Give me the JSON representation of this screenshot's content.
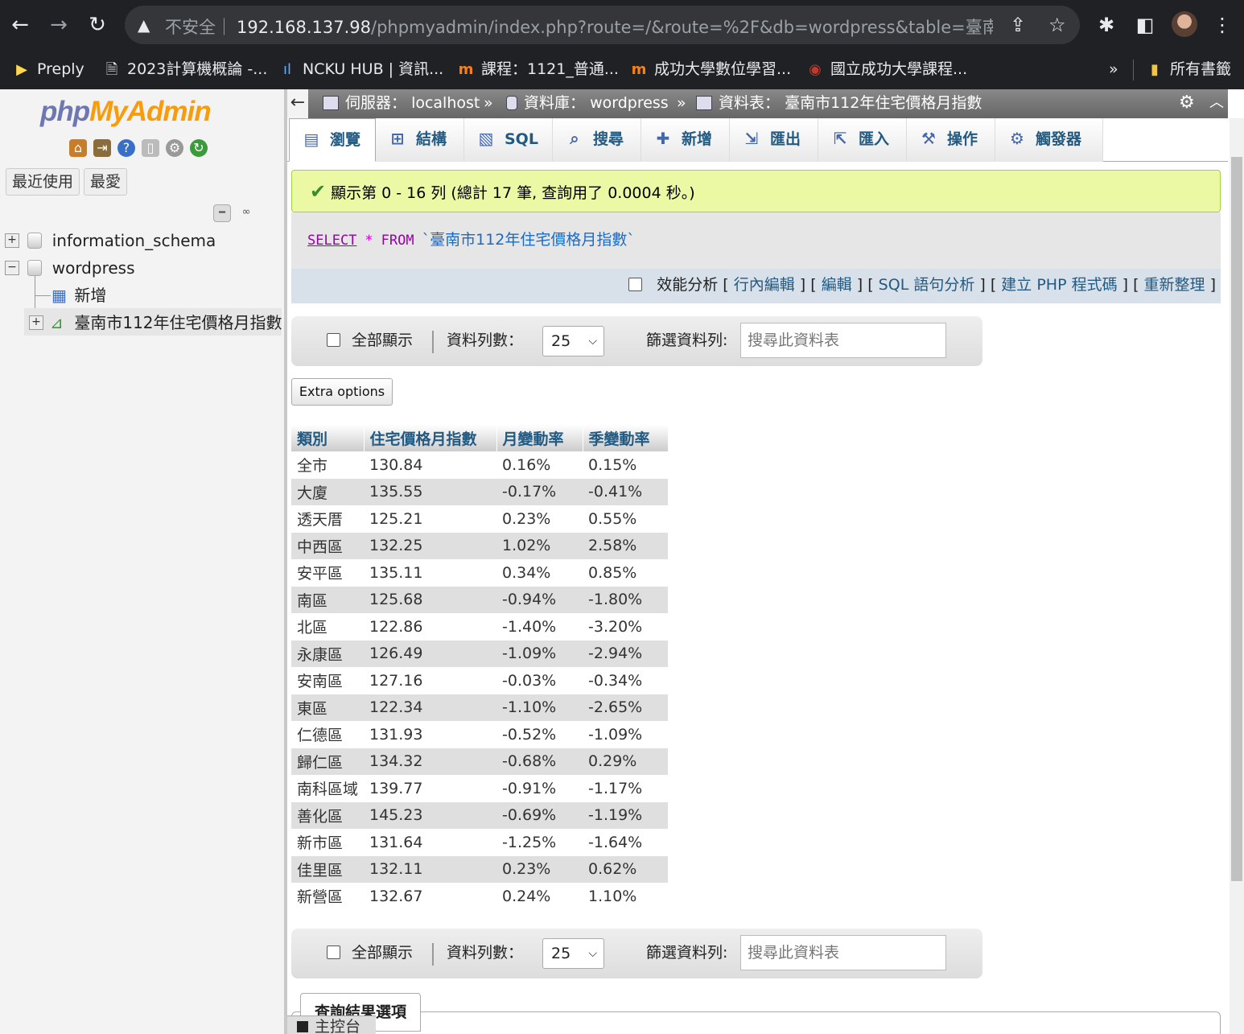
{
  "browser": {
    "insecure_label": "不安全",
    "url_host": "192.168.137.98",
    "url_rest": "/phpmyadmin/index.php?route=/&route=%2F&db=wordpress&table=臺南市...",
    "bookmarks": [
      {
        "label": "Preply",
        "icon": "preply-icon"
      },
      {
        "label": "2023計算機概論 -...",
        "icon": "document-icon"
      },
      {
        "label": "NCKU HUB | 資訊...",
        "icon": "ncku-hub-icon"
      },
      {
        "label": "課程：1121_普通...",
        "icon": "moodle-icon"
      },
      {
        "label": "成功大學數位學習...",
        "icon": "moodle-icon"
      },
      {
        "label": "國立成功大學課程...",
        "icon": "ncku-seal-icon"
      }
    ],
    "bookmarks_overflow": "»",
    "all_bookmarks": "所有書籤"
  },
  "nav": {
    "logo_php": "php",
    "logo_myadmin": "MyAdmin",
    "tabs": {
      "recent": "最近使用",
      "favorites": "最愛"
    },
    "tree": {
      "db1": "information_schema",
      "db2": "wordpress",
      "new": "新增",
      "table": "臺南市112年住宅價格月指數"
    }
  },
  "breadcrumb": {
    "server_label": "伺服器：",
    "server": "localhost",
    "db_label": "資料庫：",
    "db": "wordpress",
    "table_label": "資料表：",
    "table": "臺南市112年住宅價格月指數",
    "sep": "»"
  },
  "tabs": [
    {
      "label": "瀏覽",
      "icon": "browse-icon",
      "glyph": "▤"
    },
    {
      "label": "結構",
      "icon": "structure-icon",
      "glyph": "⊞"
    },
    {
      "label": "SQL",
      "icon": "sql-icon",
      "glyph": "▧"
    },
    {
      "label": "搜尋",
      "icon": "search-icon",
      "glyph": "⌕"
    },
    {
      "label": "新增",
      "icon": "insert-icon",
      "glyph": "✚"
    },
    {
      "label": "匯出",
      "icon": "export-icon",
      "glyph": "⇲"
    },
    {
      "label": "匯入",
      "icon": "import-icon",
      "glyph": "⇱"
    },
    {
      "label": "操作",
      "icon": "wrench-icon",
      "glyph": "⚒"
    },
    {
      "label": "觸發器",
      "icon": "trigger-icon",
      "glyph": "⚙"
    }
  ],
  "message": "顯示第 0 - 16 列 (總計 17 筆, 查詢用了 0.0004 秒。)",
  "sql": {
    "select": "SELECT",
    "star": "*",
    "from": "FROM",
    "ident": "`臺南市112年住宅價格月指數`"
  },
  "sql_links": {
    "profiling": "效能分析",
    "inline_edit": "行內編輯",
    "edit": "編輯",
    "explain": "SQL 語句分析",
    "php_code": "建立 PHP 程式碼",
    "refresh": "重新整理"
  },
  "navbar": {
    "show_all": "全部顯示",
    "rows_label": "資料列數：",
    "rows_value": "25",
    "filter_label": "篩選資料列:",
    "filter_placeholder": "搜尋此資料表"
  },
  "extra_options": "Extra options",
  "table": {
    "columns": [
      "類別",
      "住宅價格月指數",
      "月變動率",
      "季變動率"
    ],
    "rows": [
      [
        "全市",
        "130.84",
        "0.16%",
        "0.15%"
      ],
      [
        "大廈",
        "135.55",
        "-0.17%",
        "-0.41%"
      ],
      [
        "透天厝",
        "125.21",
        "0.23%",
        "0.55%"
      ],
      [
        "中西區",
        "132.25",
        "1.02%",
        "2.58%"
      ],
      [
        "安平區",
        "135.11",
        "0.34%",
        "0.85%"
      ],
      [
        "南區",
        "125.68",
        "-0.94%",
        "-1.80%"
      ],
      [
        "北區",
        "122.86",
        "-1.40%",
        "-3.20%"
      ],
      [
        "永康區",
        "126.49",
        "-1.09%",
        "-2.94%"
      ],
      [
        "安南區",
        "127.16",
        "-0.03%",
        "-0.34%"
      ],
      [
        "東區",
        "122.34",
        "-1.10%",
        "-2.65%"
      ],
      [
        "仁德區",
        "131.93",
        "-0.52%",
        "-1.09%"
      ],
      [
        "歸仁區",
        "134.32",
        "-0.68%",
        "0.29%"
      ],
      [
        "南科區域",
        "139.77",
        "-0.91%",
        "-1.17%"
      ],
      [
        "善化區",
        "145.23",
        "-0.69%",
        "-1.19%"
      ],
      [
        "新市區",
        "131.64",
        "-1.25%",
        "-1.64%"
      ],
      [
        "佳里區",
        "132.11",
        "0.23%",
        "0.62%"
      ],
      [
        "新營區",
        "132.67",
        "0.24%",
        "1.10%"
      ]
    ]
  },
  "query_results_options": "查詢結果選項",
  "console": "主控台",
  "colors": {
    "success_bg": "#ebf8a4",
    "link": "#235a81",
    "sql_keyword": "#9900aa"
  }
}
